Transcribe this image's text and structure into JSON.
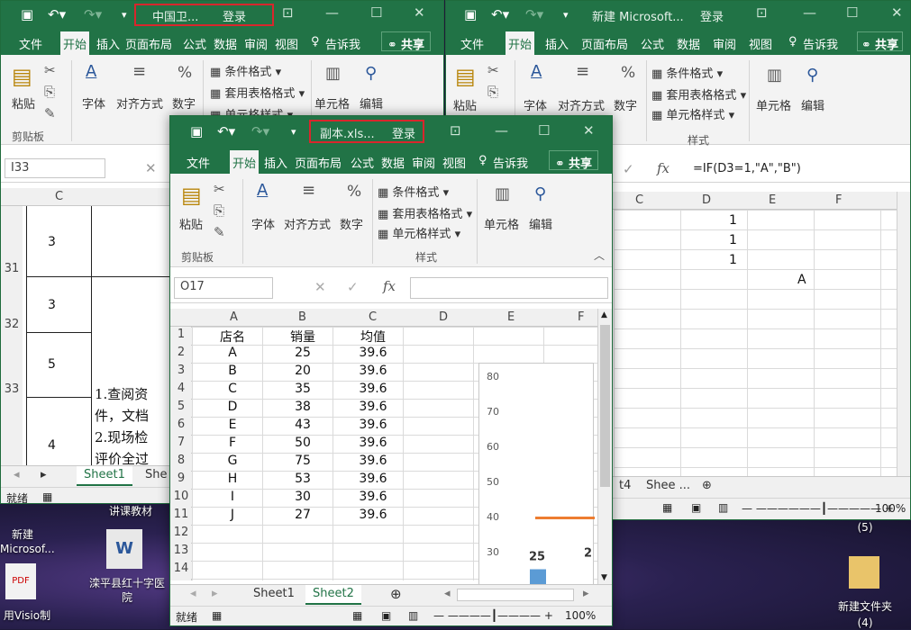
{
  "left_window": {
    "title": "中国卫...",
    "login": "登录",
    "menu": [
      "文件",
      "开始",
      "插入",
      "页面布局",
      "公式",
      "数据",
      "审阅",
      "视图"
    ],
    "tell_me": "告诉我",
    "share": "共享",
    "ribbon": {
      "paste": "粘贴",
      "clipboard": "剪贴板",
      "font": "字体",
      "align": "对齐方式",
      "number": "数字",
      "cond_format": "条件格式",
      "table_format": "套用表格格式",
      "cell_style": "单元格样式",
      "cells": "单元格",
      "edit": "编辑"
    },
    "name_box": "I33",
    "col_c": "C",
    "rows": [
      {
        "num": "31",
        "value": "3"
      },
      {
        "num": "32",
        "value": "3"
      },
      {
        "num": "33",
        "value": "5"
      },
      {
        "num": "",
        "value": "4"
      }
    ],
    "doc_lines": [
      "1.查阅资",
      "件，文档",
      "2.现场检",
      "评价全过"
    ],
    "tabs": [
      "Sheet1",
      "She"
    ],
    "status": "就绪"
  },
  "right_window": {
    "title": "新建 Microsoft...",
    "login": "登录",
    "menu": [
      "文件",
      "开始",
      "插入",
      "页面布局",
      "公式",
      "数据",
      "审阅",
      "视图"
    ],
    "tell_me": "告诉我",
    "share": "共享",
    "ribbon": {
      "paste": "粘贴",
      "font": "字体",
      "align": "对齐方式",
      "number": "数字",
      "cond_format": "条件格式",
      "table_format": "套用表格格式",
      "cell_style": "单元格样式",
      "style_group": "样式",
      "cells": "单元格",
      "edit": "编辑"
    },
    "formula": "=IF(D3=1,\"A\",\"B\")",
    "columns": [
      "C",
      "D",
      "E",
      "F"
    ],
    "d_values": [
      "1",
      "1",
      "1"
    ],
    "e_value": "A",
    "tabs": [
      "t4",
      "Shee ..."
    ],
    "zoom": "100%"
  },
  "front_window": {
    "title": "副本.xls...",
    "login": "登录",
    "menu": [
      "文件",
      "开始",
      "插入",
      "页面布局",
      "公式",
      "数据",
      "审阅",
      "视图"
    ],
    "tell_me": "告诉我",
    "share": "共享",
    "ribbon": {
      "paste": "粘贴",
      "clipboard": "剪贴板",
      "font": "字体",
      "align": "对齐方式",
      "number": "数字",
      "cond_format": "条件格式",
      "table_format": "套用表格格式",
      "cell_style": "单元格样式",
      "style_group": "样式",
      "cells": "单元格",
      "edit": "编辑"
    },
    "name_box": "O17",
    "columns": [
      "A",
      "B",
      "C",
      "D",
      "E",
      "F"
    ],
    "header_row": [
      "店名",
      "销量",
      "均值"
    ],
    "data_rows": [
      [
        "A",
        "25",
        "39.6"
      ],
      [
        "B",
        "20",
        "39.6"
      ],
      [
        "C",
        "35",
        "39.6"
      ],
      [
        "D",
        "38",
        "39.6"
      ],
      [
        "E",
        "43",
        "39.6"
      ],
      [
        "F",
        "50",
        "39.6"
      ],
      [
        "G",
        "75",
        "39.6"
      ],
      [
        "H",
        "53",
        "39.6"
      ],
      [
        "I",
        "30",
        "39.6"
      ],
      [
        "J",
        "27",
        "39.6"
      ]
    ],
    "row_numbers": [
      "1",
      "2",
      "3",
      "4",
      "5",
      "6",
      "7",
      "8",
      "9",
      "10",
      "11",
      "12",
      "13",
      "14"
    ],
    "tabs": [
      "Sheet1",
      "Sheet2"
    ],
    "status": "就绪",
    "zoom": "100%"
  },
  "chart_data": {
    "type": "bar",
    "y_ticks": [
      "80",
      "70",
      "60",
      "50",
      "40",
      "30"
    ],
    "visible_bar_label": "25",
    "partial_label": "2",
    "mean_line": 39.6
  },
  "desktop": {
    "icons": [
      "讲课教材",
      "新建 Microsof...",
      "滦平县红十字医院",
      "用Visio制",
      "新建文件夹",
      "(5)",
      "(4)"
    ]
  },
  "colors": {
    "excel_green": "#217346",
    "bar_blue": "#5b9bd5",
    "mean_orange": "#ed7d31",
    "highlight_red": "#d9262c"
  }
}
